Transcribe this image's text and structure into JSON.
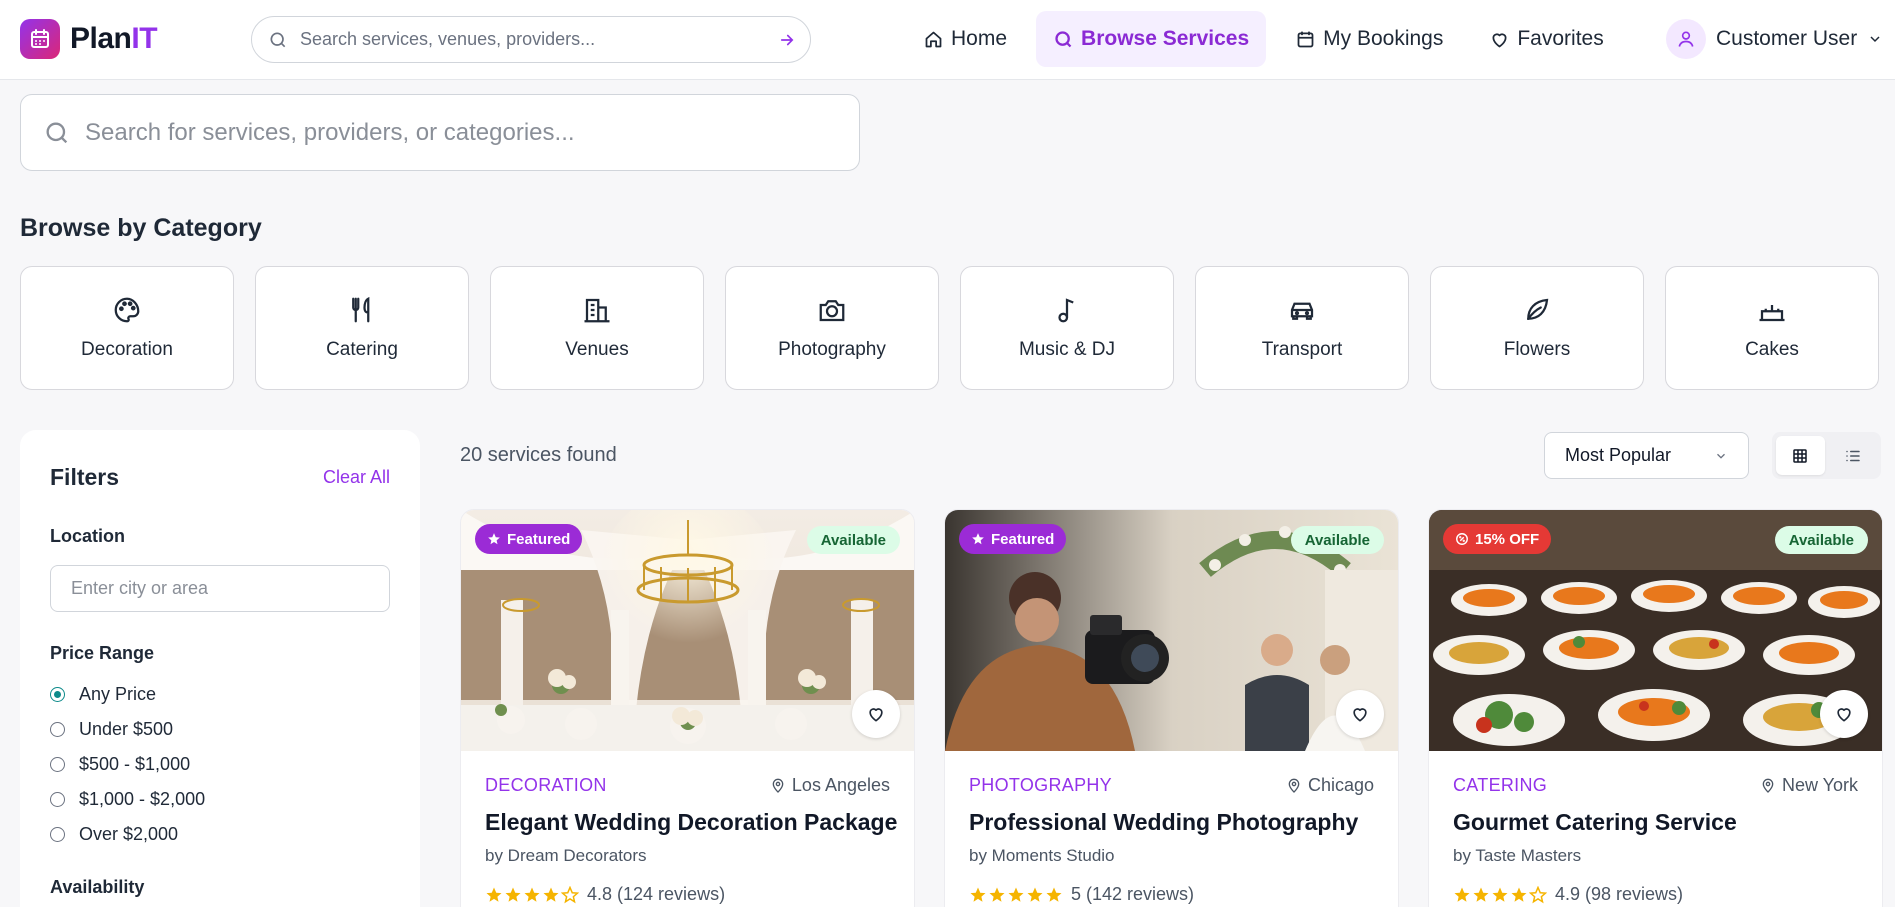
{
  "header": {
    "logo_plan": "Plan",
    "logo_it": "IT",
    "search_placeholder": "Search services, venues, providers...",
    "nav": [
      {
        "label": "Home",
        "icon": "home-icon"
      },
      {
        "label": "Browse Services",
        "icon": "search-icon",
        "active": true
      },
      {
        "label": "My Bookings",
        "icon": "calendar-icon"
      },
      {
        "label": "Favorites",
        "icon": "heart-icon"
      }
    ],
    "user_name": "Customer User"
  },
  "main_search": {
    "placeholder": "Search for services, providers, or categories..."
  },
  "categories": {
    "title": "Browse by Category",
    "items": [
      {
        "label": "Decoration",
        "icon": "palette-icon"
      },
      {
        "label": "Catering",
        "icon": "utensils-icon"
      },
      {
        "label": "Venues",
        "icon": "building-icon"
      },
      {
        "label": "Photography",
        "icon": "camera-icon"
      },
      {
        "label": "Music & DJ",
        "icon": "music-note-icon"
      },
      {
        "label": "Transport",
        "icon": "car-icon"
      },
      {
        "label": "Flowers",
        "icon": "leaf-icon"
      },
      {
        "label": "Cakes",
        "icon": "cake-icon"
      }
    ]
  },
  "filters": {
    "title": "Filters",
    "clear_all": "Clear All",
    "location_label": "Location",
    "location_placeholder": "Enter city or area",
    "price_label": "Price Range",
    "price_options": [
      {
        "label": "Any Price",
        "checked": true
      },
      {
        "label": "Under $500",
        "checked": false
      },
      {
        "label": "$500 - $1,000",
        "checked": false
      },
      {
        "label": "$1,000 - $2,000",
        "checked": false
      },
      {
        "label": "Over $2,000",
        "checked": false
      }
    ],
    "availability_label": "Availability"
  },
  "results": {
    "count_text": "20 services found",
    "sort_selected": "Most Popular"
  },
  "cards": [
    {
      "badge": "Featured",
      "badge_type": "featured",
      "availability": "Available",
      "category": "DECORATION",
      "location": "Los Angeles",
      "title": "Elegant Wedding Decoration Package",
      "provider": "by Dream Decorators",
      "rating_text": "4.8 (124 reviews)",
      "stars": 4.5,
      "image": "decoration-hall-photo"
    },
    {
      "badge": "Featured",
      "badge_type": "featured",
      "availability": "Available",
      "category": "PHOTOGRAPHY",
      "location": "Chicago",
      "title": "Professional Wedding Photography",
      "provider": "by Moments Studio",
      "rating_text": "5 (142 reviews)",
      "stars": 5,
      "image": "wedding-photographer-photo"
    },
    {
      "badge": "15% OFF",
      "badge_type": "discount",
      "availability": "Available",
      "category": "CATERING",
      "location": "New York",
      "title": "Gourmet Catering Service",
      "provider": "by Taste Masters",
      "rating_text": "4.9 (98 reviews)",
      "stars": 4.5,
      "image": "catering-buffet-photo"
    }
  ],
  "colors": {
    "accent": "#9333ea",
    "available_bg": "#dcfce7",
    "star": "#f5b400"
  }
}
